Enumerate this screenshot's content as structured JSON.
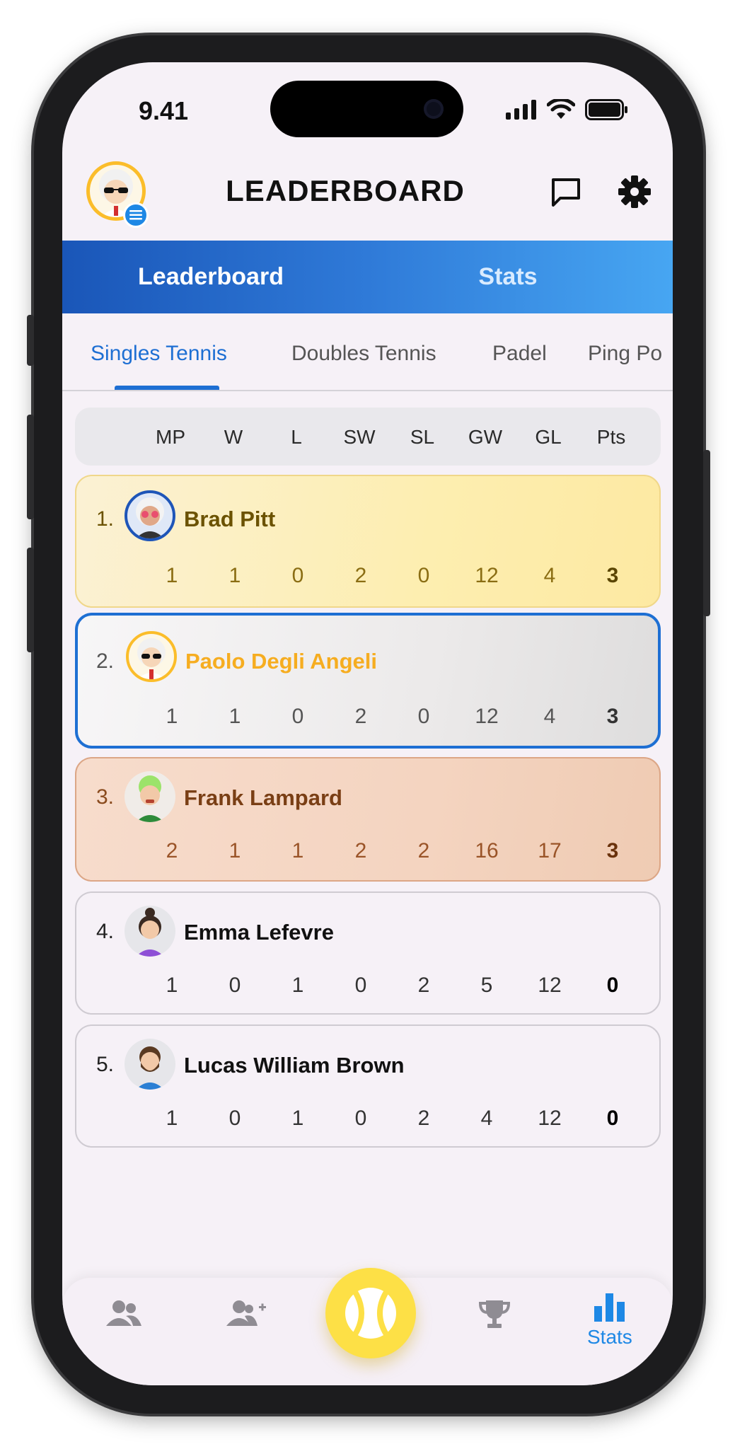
{
  "status_bar": {
    "time": "9.41"
  },
  "header": {
    "title": "LEADERBOARD"
  },
  "top_tabs": [
    {
      "label": "Leaderboard",
      "active": true
    },
    {
      "label": "Stats",
      "active": false
    }
  ],
  "sport_tabs": [
    {
      "label": "Singles Tennis",
      "active": true
    },
    {
      "label": "Doubles Tennis",
      "active": false
    },
    {
      "label": "Padel",
      "active": false
    },
    {
      "label": "Ping Po",
      "active": false
    }
  ],
  "columns": [
    "MP",
    "W",
    "L",
    "SW",
    "SL",
    "GW",
    "GL",
    "Pts"
  ],
  "rows": [
    {
      "rank": "1.",
      "name": "Brad Pitt",
      "stats": [
        "1",
        "1",
        "0",
        "2",
        "0",
        "12",
        "4",
        "3"
      ],
      "tier": "gold"
    },
    {
      "rank": "2.",
      "name": "Paolo Degli Angeli",
      "stats": [
        "1",
        "1",
        "0",
        "2",
        "0",
        "12",
        "4",
        "3"
      ],
      "tier": "silver"
    },
    {
      "rank": "3.",
      "name": "Frank Lampard",
      "stats": [
        "2",
        "1",
        "1",
        "2",
        "2",
        "16",
        "17",
        "3"
      ],
      "tier": "bronze"
    },
    {
      "rank": "4.",
      "name": "Emma Lefevre",
      "stats": [
        "1",
        "0",
        "1",
        "0",
        "2",
        "5",
        "12",
        "0"
      ],
      "tier": "plain"
    },
    {
      "rank": "5.",
      "name": "Lucas William Brown",
      "stats": [
        "1",
        "0",
        "1",
        "0",
        "2",
        "4",
        "12",
        "0"
      ],
      "tier": "plain"
    }
  ],
  "bottom_nav": {
    "items": [
      {
        "icon": "people-icon",
        "label": ""
      },
      {
        "icon": "add-person-icon",
        "label": ""
      },
      {
        "icon": "tennis-ball-icon",
        "label": ""
      },
      {
        "icon": "trophy-icon",
        "label": ""
      },
      {
        "icon": "bar-chart-icon",
        "label": "Stats",
        "active": true
      }
    ]
  },
  "colors": {
    "accent": "#1e6fd3",
    "gold": "#fde9a2",
    "silver": "#e6e5e5",
    "bronze": "#f3d2bd",
    "fab": "#fde046"
  }
}
